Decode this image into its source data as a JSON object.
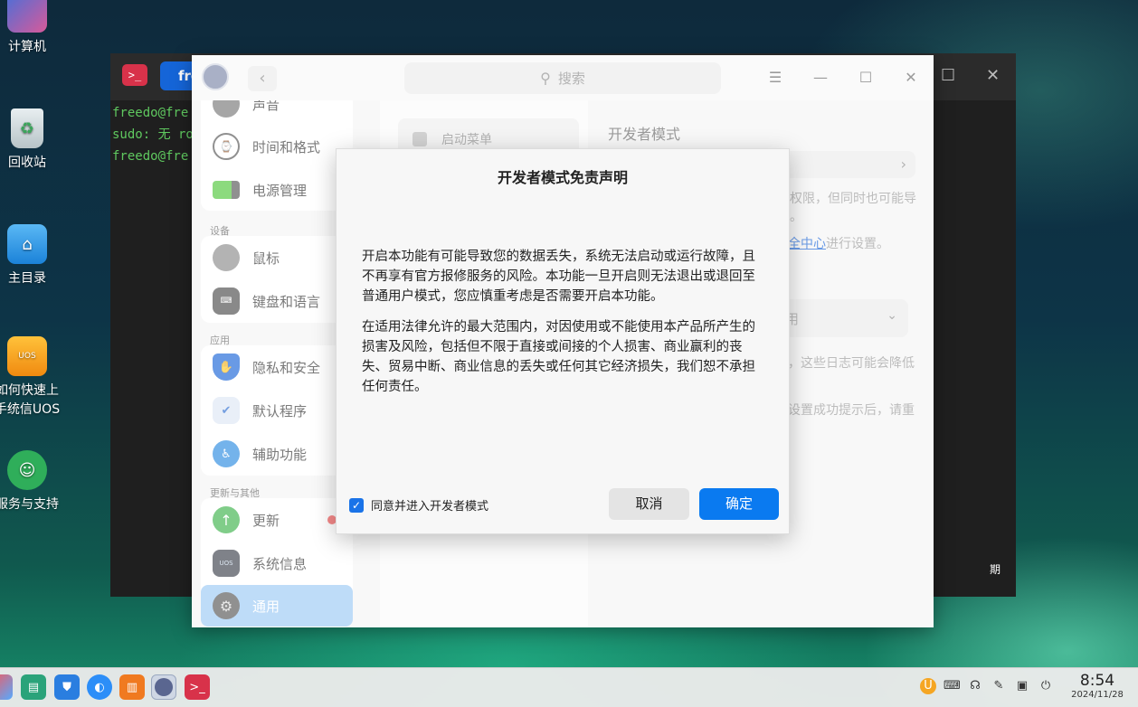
{
  "desktop": {
    "icons": [
      {
        "label": "计算机",
        "icon": "computer-icon"
      },
      {
        "label": "回收站",
        "icon": "trash-icon"
      },
      {
        "label": "主目录",
        "icon": "home-folder-icon"
      },
      {
        "label": "如何快速上手统信UOS",
        "line1": "如何快速上",
        "line2": "手统信UOS",
        "icon": "uos-guide-icon"
      },
      {
        "label": "服务与支持",
        "icon": "support-icon"
      }
    ]
  },
  "terminal": {
    "tab_label": "fre",
    "lines": [
      "freedo@fre",
      "sudo: 无 ro",
      "freedo@fre"
    ],
    "trailing_text": "期"
  },
  "settings": {
    "search_placeholder": "搜索",
    "sidebar": {
      "groups": [
        {
          "header": "",
          "items": [
            {
              "label": "声音",
              "icon": "sound-icon"
            },
            {
              "label": "时间和格式",
              "icon": "clock-icon"
            },
            {
              "label": "电源管理",
              "icon": "battery-icon"
            }
          ]
        },
        {
          "header": "设备",
          "items": [
            {
              "label": "鼠标",
              "icon": "mouse-icon"
            },
            {
              "label": "键盘和语言",
              "icon": "keyboard-icon"
            }
          ]
        },
        {
          "header": "应用",
          "items": [
            {
              "label": "隐私和安全",
              "icon": "shield-hand-icon"
            },
            {
              "label": "默认程序",
              "icon": "default-apps-icon"
            },
            {
              "label": "辅助功能",
              "icon": "accessibility-icon"
            }
          ]
        },
        {
          "header": "更新与其他",
          "items": [
            {
              "label": "更新",
              "icon": "update-arrow-icon",
              "badge": true
            },
            {
              "label": "系统信息",
              "icon": "system-info-icon"
            },
            {
              "label": "通用",
              "icon": "gear-icon",
              "active": true
            }
          ]
        }
      ]
    },
    "content": {
      "left_item": "启动菜单",
      "right_title": "开发者模式",
      "fragment_1": "权限，但同时也可能导",
      "fragment_2": "。",
      "fragment_3_link": "全中心",
      "fragment_3_rest": "进行设置。",
      "fragment_4": "，这些日志可能会降低",
      "fragment_5": "设置成功提示后，请重",
      "select_fragment": "用"
    }
  },
  "dialog": {
    "title": "开发者模式免责声明",
    "paragraph_1": "开启本功能有可能导致您的数据丢失，系统无法启动或运行故障，且不再享有官方报修服务的风险。本功能一旦开启则无法退出或退回至普通用户模式，您应慎重考虑是否需要开启本功能。",
    "paragraph_2": "在适用法律允许的最大范围内，对因使用或不能使用本产品所产生的损害及风险，包括但不限于直接或间接的个人损害、商业赢利的丧失、贸易中断、商业信息的丢失或任何其它经济损失，我们恕不承担任何责任。",
    "checkbox_label": "同意并进入开发者模式",
    "checkbox_checked": true,
    "cancel_label": "取消",
    "ok_label": "确定"
  },
  "taskbar": {
    "time": "8:54",
    "date": "2024/11/28"
  },
  "colors": {
    "accent": "#0a7af0",
    "sidebar_active": "#9ccaf5",
    "terminal_green": "#5fc85f"
  }
}
